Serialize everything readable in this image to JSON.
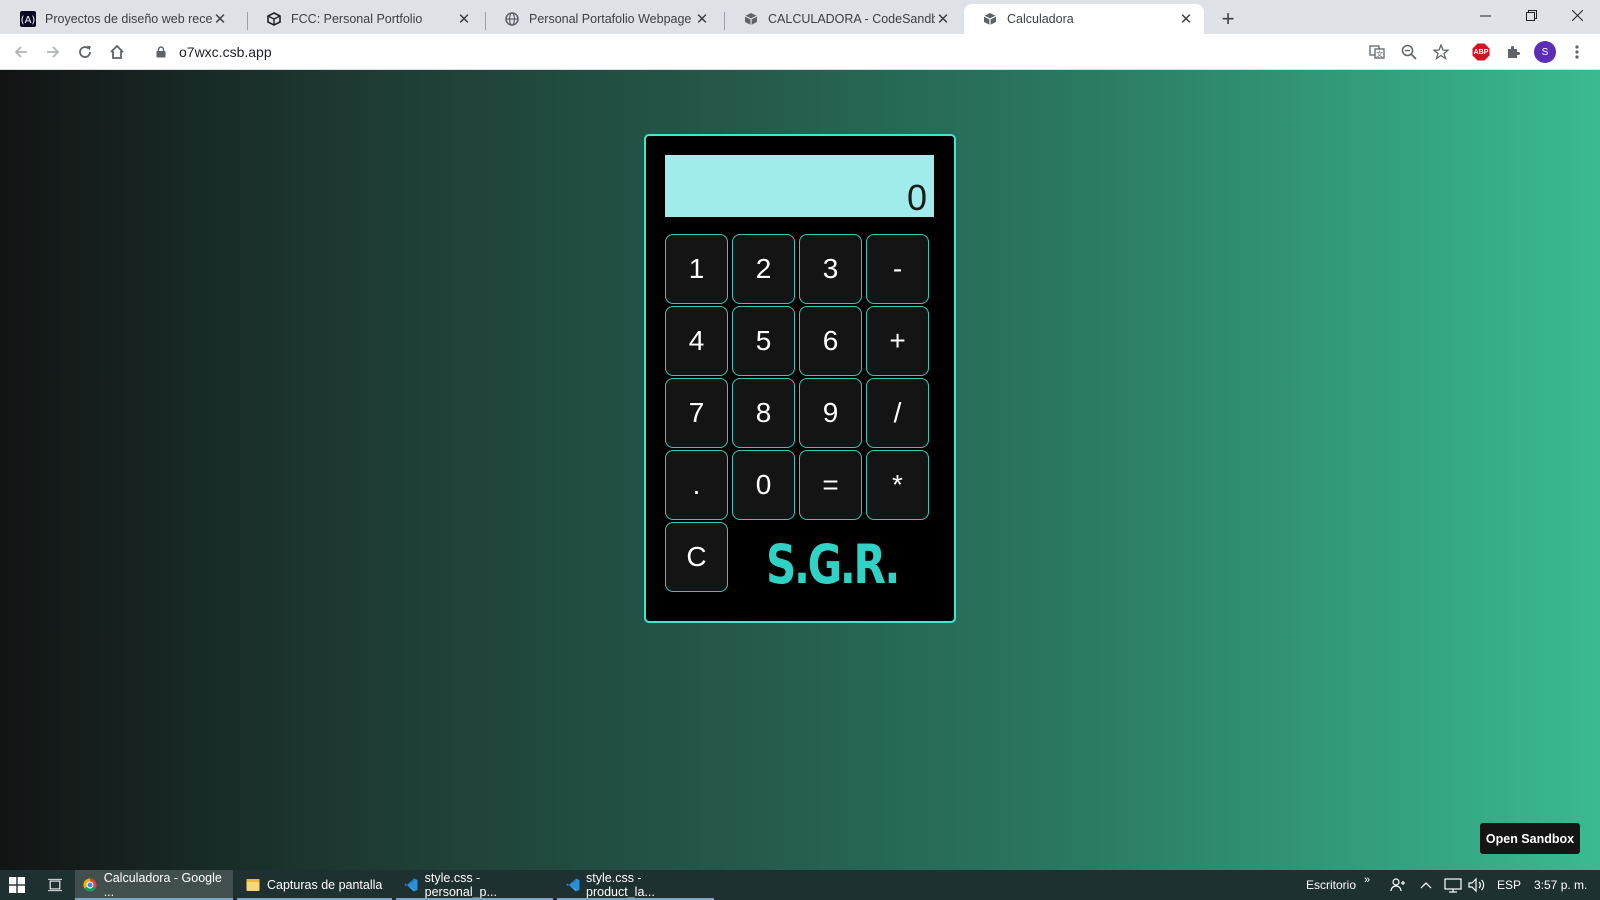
{
  "browser": {
    "tabs": [
      {
        "title": "Proyectos de diseño web receptivo",
        "icon": "fcc-logo-icon",
        "active": false
      },
      {
        "title": "FCC: Personal Portfolio",
        "icon": "codesandbox-icon",
        "active": false
      },
      {
        "title": "Personal Portafolio Webpage",
        "icon": "globe-icon",
        "active": false
      },
      {
        "title": "CALCULADORA - CodeSandbox",
        "icon": "codesandbox-icon",
        "active": false
      },
      {
        "title": "Calculadora",
        "icon": "codesandbox-icon",
        "active": true
      }
    ],
    "url": "o7wxc.csb.app",
    "profile_initial": "S",
    "adblock_label": "ABP"
  },
  "calculator": {
    "display": "0",
    "keys": [
      "1",
      "2",
      "3",
      "-",
      "4",
      "5",
      "6",
      "+",
      "7",
      "8",
      "9",
      "/",
      ".",
      "0",
      "=",
      "*"
    ],
    "clear_key": "C",
    "brand": "S.G.R."
  },
  "page": {
    "open_sandbox_label": "Open Sandbox"
  },
  "taskbar": {
    "items": [
      {
        "label": "Calculadora - Google ...",
        "icon": "chrome-icon",
        "active": true
      },
      {
        "label": "Capturas de pantalla",
        "icon": "folder-icon",
        "active": false
      },
      {
        "label": "style.css - personal_p...",
        "icon": "vscode-icon",
        "active": false
      },
      {
        "label": "style.css - product_la...",
        "icon": "vscode-icon",
        "active": false
      }
    ],
    "desktop_label": "Escritorio",
    "language": "ESP",
    "time": "3:57 p. m."
  },
  "colors": {
    "calculator_border": "#3ee6d6",
    "display_bg": "#a0ecea",
    "brand": "#2fd2c4",
    "gradient_start": "#121414",
    "gradient_end": "#3aba92"
  }
}
